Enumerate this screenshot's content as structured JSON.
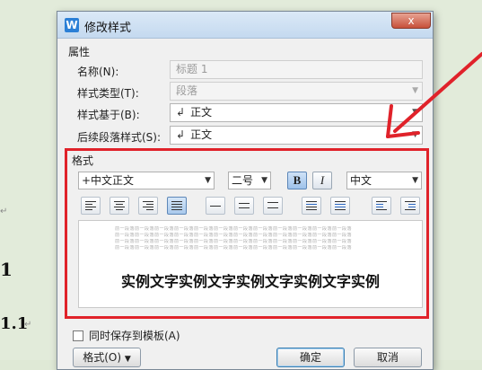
{
  "background_doc": {
    "heading1": "1",
    "heading2": "1.1",
    "return_mark": "↵"
  },
  "dialog": {
    "title": "修改样式",
    "app_icon_letter": "W",
    "close_symbol": "x",
    "properties_title": "属性",
    "name_label": "名称(N):",
    "name_value": "标题 1",
    "style_type_label": "样式类型(T):",
    "style_type_value": "段落",
    "based_on_label": "样式基于(B):",
    "based_on_value": "正文",
    "following_label": "后续段落样式(S):",
    "following_value": "正文",
    "format_title": "格式",
    "font_value": "+中文正文",
    "size_value": "二号",
    "bold_label": "B",
    "italic_label": "I",
    "language_value": "中文",
    "preview_prev_text": "前一段落前一段落前一段落前一段落前一段落前一段落前一段落前一段落前一段落前一段落前一段落前一段落",
    "preview_sample": "实例文字实例文字实例文字实例文字实例",
    "save_template_label": "同时保存到模板(A)",
    "format_button": "格式(O)",
    "ok_button": "确定",
    "cancel_button": "取消",
    "paragraph_glyph": "↲"
  },
  "colors": {
    "annotation_red": "#e0222a"
  }
}
